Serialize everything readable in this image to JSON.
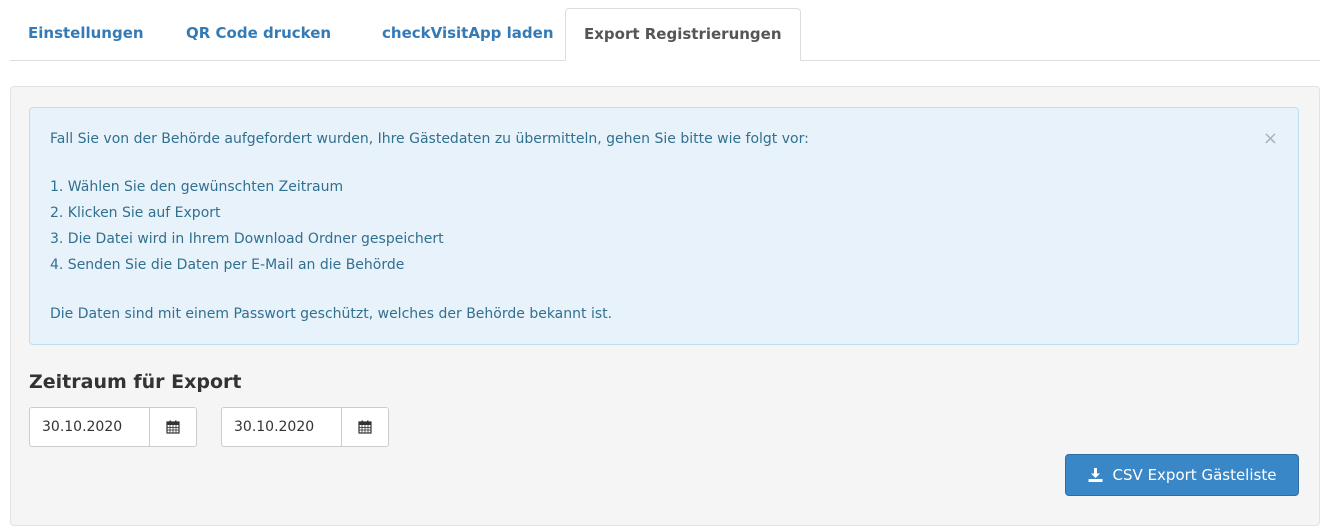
{
  "tabs": [
    {
      "label": "Einstellungen",
      "active": false
    },
    {
      "label": "QR Code drucken",
      "active": false
    },
    {
      "label": "checkVisitApp laden",
      "active": false
    },
    {
      "label": "Export Registrierungen",
      "active": true
    }
  ],
  "alert": {
    "intro": "Fall Sie von der Behörde aufgefordert wurden, Ihre Gästedaten zu übermitteln, gehen Sie bitte wie folgt vor:",
    "steps": [
      "1. Wählen Sie den gewünschten Zeitraum",
      "2. Klicken Sie auf Export",
      "3. Die Datei wird in Ihrem Download Ordner gespeichert",
      "4. Senden Sie die Daten per E-Mail an die Behörde"
    ],
    "note": "Die Daten sind mit einem Passwort geschützt, welches der Behörde bekannt ist.",
    "close_symbol": "×"
  },
  "export": {
    "title": "Zeitraum für Export",
    "date_from": "30.10.2020",
    "date_to": "30.10.2020",
    "calendar_icon": "calendar-icon"
  },
  "csv_button": {
    "label": "CSV Export Gästeliste",
    "icon": "download-icon"
  },
  "colors": {
    "link": "#337ab7",
    "alert_bg": "#e8f2fb",
    "alert_text": "#31708f",
    "button_bg": "#3a87c8"
  }
}
